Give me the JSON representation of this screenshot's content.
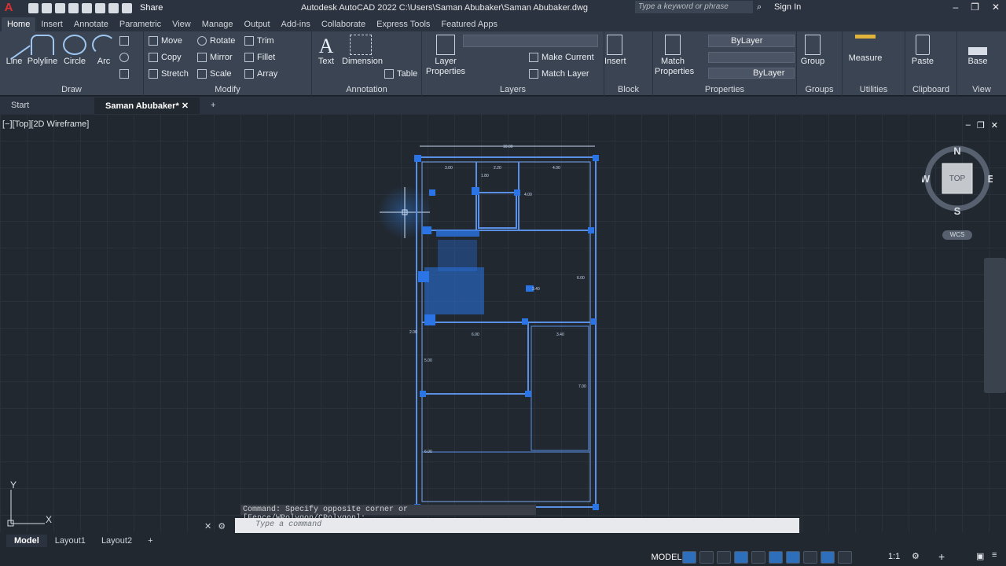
{
  "titlebar": {
    "share": "Share",
    "title": "Autodesk AutoCAD 2022    C:\\Users\\Saman Abubaker\\Saman Abubaker.dwg",
    "search_placeholder": "Type a keyword or phrase",
    "signin": "Sign In"
  },
  "ribbon_tabs": [
    "Home",
    "Insert",
    "Annotate",
    "Parametric",
    "View",
    "Manage",
    "Output",
    "Add-ins",
    "Collaborate",
    "Express Tools",
    "Featured Apps"
  ],
  "draw": {
    "line": "Line",
    "polyline": "Polyline",
    "circle": "Circle",
    "arc": "Arc",
    "label": "Draw"
  },
  "modify": {
    "move": "Move",
    "rotate": "Rotate",
    "trim": "Trim",
    "copy": "Copy",
    "mirror": "Mirror",
    "fillet": "Fillet",
    "stretch": "Stretch",
    "scale": "Scale",
    "array": "Array",
    "label": "Modify"
  },
  "annotation": {
    "text": "Text",
    "dimension": "Dimension",
    "table": "Table",
    "label": "Annotation"
  },
  "layers": {
    "layer_properties": "Layer Properties",
    "make_current": "Make Current",
    "match_layer": "Match Layer",
    "label": "Layers"
  },
  "block": {
    "insert": "Insert",
    "label": "Block"
  },
  "properties": {
    "match_properties": "Match Properties",
    "bylayer1": "ByLayer",
    "bylayer2": "ByLayer",
    "label": "Properties"
  },
  "groups": {
    "group": "Group",
    "label": "Groups"
  },
  "utilities": {
    "measure": "Measure",
    "label": "Utilities"
  },
  "clipboard": {
    "paste": "Paste",
    "label": "Clipboard"
  },
  "view": {
    "base": "Base",
    "label": "View"
  },
  "doc_tabs": {
    "start": "Start",
    "active": "Saman Abubaker*"
  },
  "viewport": {
    "label": "[−][Top][2D Wireframe]",
    "wcs": "WCS",
    "compass": {
      "n": "N",
      "s": "S",
      "e": "E",
      "w": "W",
      "top": "TOP"
    }
  },
  "dims": [
    "10.00",
    "3.00",
    "2.20",
    "4.00",
    "1.80",
    "4.00",
    "6.00",
    "3.40",
    "6.00",
    "3.40",
    "7.00",
    "5.00",
    "6.00",
    "2.00"
  ],
  "command": {
    "history": "Command: Specify opposite corner or [Fence/WPolygon/CPolygon]:",
    "placeholder": "Type a command"
  },
  "layout_tabs": [
    "Model",
    "Layout1",
    "Layout2"
  ],
  "status": {
    "model": "MODEL",
    "scale": "1:1"
  },
  "ucs": {
    "x": "X",
    "y": "Y"
  }
}
